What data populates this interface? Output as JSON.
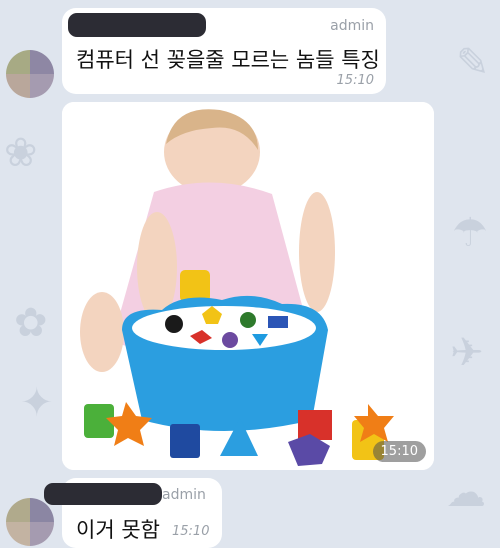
{
  "colors": {
    "background": "#dfe5ee",
    "bubble": "#ffffff",
    "sender_mask": "#2c2c34",
    "meta_text": "#9aa0a8"
  },
  "messages": [
    {
      "sender": "",
      "role": "admin",
      "text": "컴퓨터 선 꽂을줄 모르는 놈들 특징",
      "time": "15:10"
    },
    {
      "type": "photo",
      "description_icon": "toy-image",
      "time": "15:10"
    },
    {
      "sender": "",
      "role": "admin",
      "text": "이거 못함",
      "time": "15:10"
    }
  ]
}
